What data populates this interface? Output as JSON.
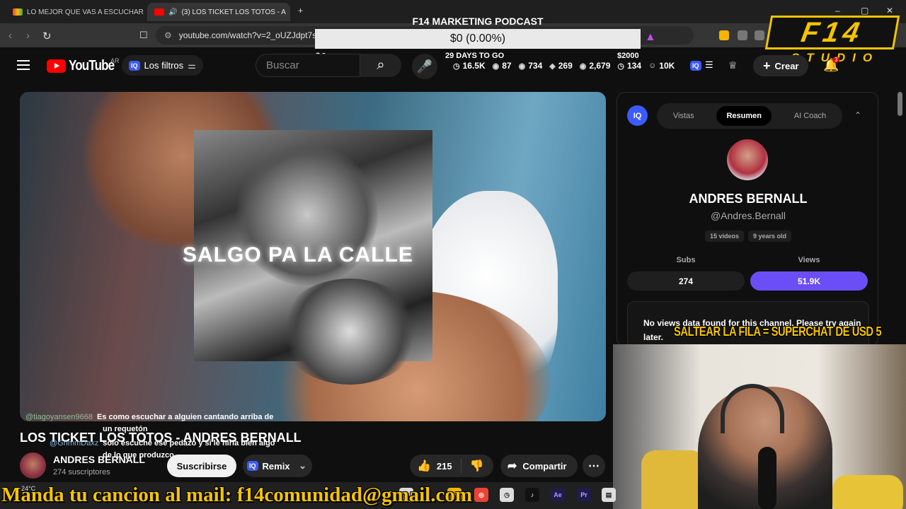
{
  "browser": {
    "tabs": [
      {
        "label": "LO MEJOR QUE VAS A ESCUCHAR ES",
        "favicon": "gmail-icon",
        "active": false
      },
      {
        "label": "(3) LOS TICKET LOS TOTOS - A",
        "favicon": "youtube-icon",
        "active": true
      }
    ],
    "url": "youtube.com/watch?v=2_oUZJdpt7s",
    "colors": {
      "accent": "#7e3cf5",
      "youtube_red": "#ff0000"
    }
  },
  "overlay": {
    "podcast_title": "F14 MARKETING PODCAST",
    "goal_bar_text": "$0 (0.00%)",
    "goal_progress": 0,
    "goal_amount": "$0",
    "days_left": "29 DAYS TO GO",
    "goal_target": "$2000",
    "stats": [
      {
        "icon": "clock-icon",
        "value": "16.5K"
      },
      {
        "icon": "eye-icon",
        "value": "87"
      },
      {
        "icon": "eye-icon",
        "value": "734"
      },
      {
        "icon": "tag-icon",
        "value": "269"
      },
      {
        "icon": "eye-icon",
        "value": "2,679"
      },
      {
        "icon": "clock-icon",
        "value": "134"
      },
      {
        "icon": "person-icon",
        "value": "10K"
      }
    ],
    "logo_main": "F14",
    "logo_sub": "STUDIO",
    "supertitle": "SALTEAR LA FILA = SUPERCHAT DE USD 5",
    "ticker": "Manda tu cancion al mail: f14comunidad@gmail.com"
  },
  "youtube": {
    "logo_text": "YouTube",
    "region": "AR",
    "filters_label": "Los filtros",
    "search_placeholder": "Buscar",
    "create_label": "Crear",
    "notification_count": "3"
  },
  "video": {
    "overlay_text": "SALGO PA LA CALLE",
    "title": "LOS TICKET LOS TOTOS - ANDRES BERNALL",
    "channel_name": "ANDRES BERNALL",
    "subscribers": "274 suscriptores",
    "subscribe_label": "Suscribirse",
    "remix_label": "Remix",
    "likes": "215",
    "share_label": "Compartir",
    "chat": [
      {
        "user": "@tiagoyansen9668",
        "message": "Es como escuchar a alguien cantando arriba de"
      },
      {
        "user": "",
        "message": "un requetón"
      },
      {
        "user": "@GrimmDaxz",
        "message": "solo escuche ese pedazo y si le hiria bien algo"
      },
      {
        "user": "",
        "message": "de lo que produzco"
      }
    ]
  },
  "panel": {
    "tabs": [
      "Vistas",
      "Resumen",
      "AI Coach"
    ],
    "active_tab": "Resumen",
    "channel_name": "ANDRES BERNALL",
    "handle": "@Andres.Bernall",
    "videos": "15 videos",
    "age": "9 years old",
    "subs_label": "Subs",
    "views_label": "Views",
    "subs_value": "274",
    "views_value": "51.9K",
    "message": "No views data found for this channel. Please try again later."
  },
  "taskbar": {
    "weather": "24°C"
  }
}
